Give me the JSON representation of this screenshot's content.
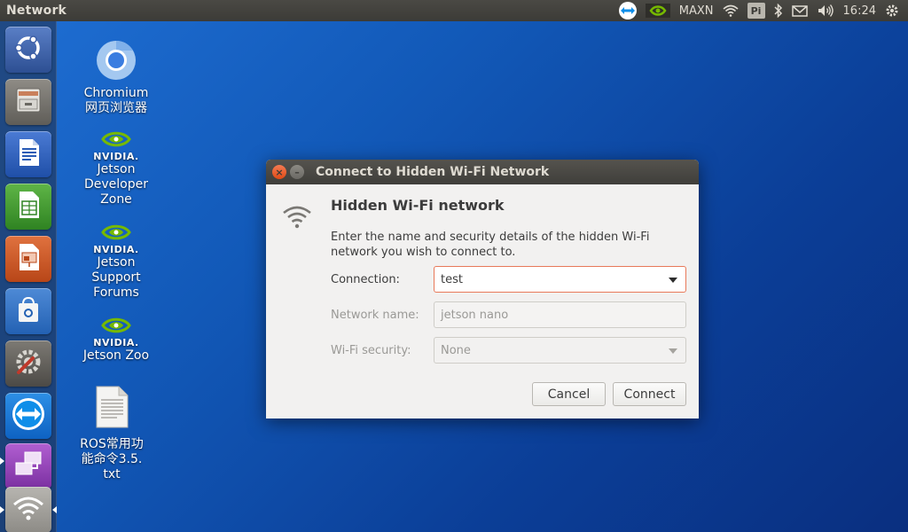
{
  "top_panel": {
    "app_title": "Network",
    "power_mode": "MAXN",
    "pi_label": "Pi",
    "clock": "16:24"
  },
  "launcher": {
    "items": [
      {
        "name": "ubuntu-dash"
      },
      {
        "name": "files"
      },
      {
        "name": "libreoffice-writer"
      },
      {
        "name": "libreoffice-calc"
      },
      {
        "name": "libreoffice-impress"
      },
      {
        "name": "ubuntu-software"
      },
      {
        "name": "system-settings"
      },
      {
        "name": "teamviewer"
      },
      {
        "name": "remote-desktop"
      },
      {
        "name": "network"
      }
    ]
  },
  "desktop": {
    "icons": [
      {
        "label": "Chromium\n网页浏览器",
        "icon": "chromium-icon"
      },
      {
        "label": "Jetson\nDeveloper\nZone",
        "icon": "nvidia-icon",
        "logo_text": "NVIDIA."
      },
      {
        "label": "Jetson\nSupport\nForums",
        "icon": "nvidia-icon",
        "logo_text": "NVIDIA."
      },
      {
        "label": "Jetson Zoo",
        "icon": "nvidia-icon",
        "logo_text": "NVIDIA."
      },
      {
        "label": "ROS常用功\n能命令3.5.\ntxt",
        "icon": "text-file-icon"
      }
    ]
  },
  "dialog": {
    "title": "Connect to Hidden Wi-Fi Network",
    "heading": "Hidden Wi-Fi network",
    "description": "Enter the name and security details of the hidden Wi-Fi network you wish to connect to.",
    "connection_label": "Connection:",
    "connection_value": "test",
    "network_name_label": "Network name:",
    "network_name_value": "jetson nano",
    "security_label": "Wi-Fi security:",
    "security_value": "None",
    "cancel_label": "Cancel",
    "connect_label": "Connect"
  },
  "colors": {
    "accent": "#e8795a",
    "panel": "#3c3b37",
    "close_button": "#df4a16",
    "desktop_blue": "#1259b8"
  }
}
